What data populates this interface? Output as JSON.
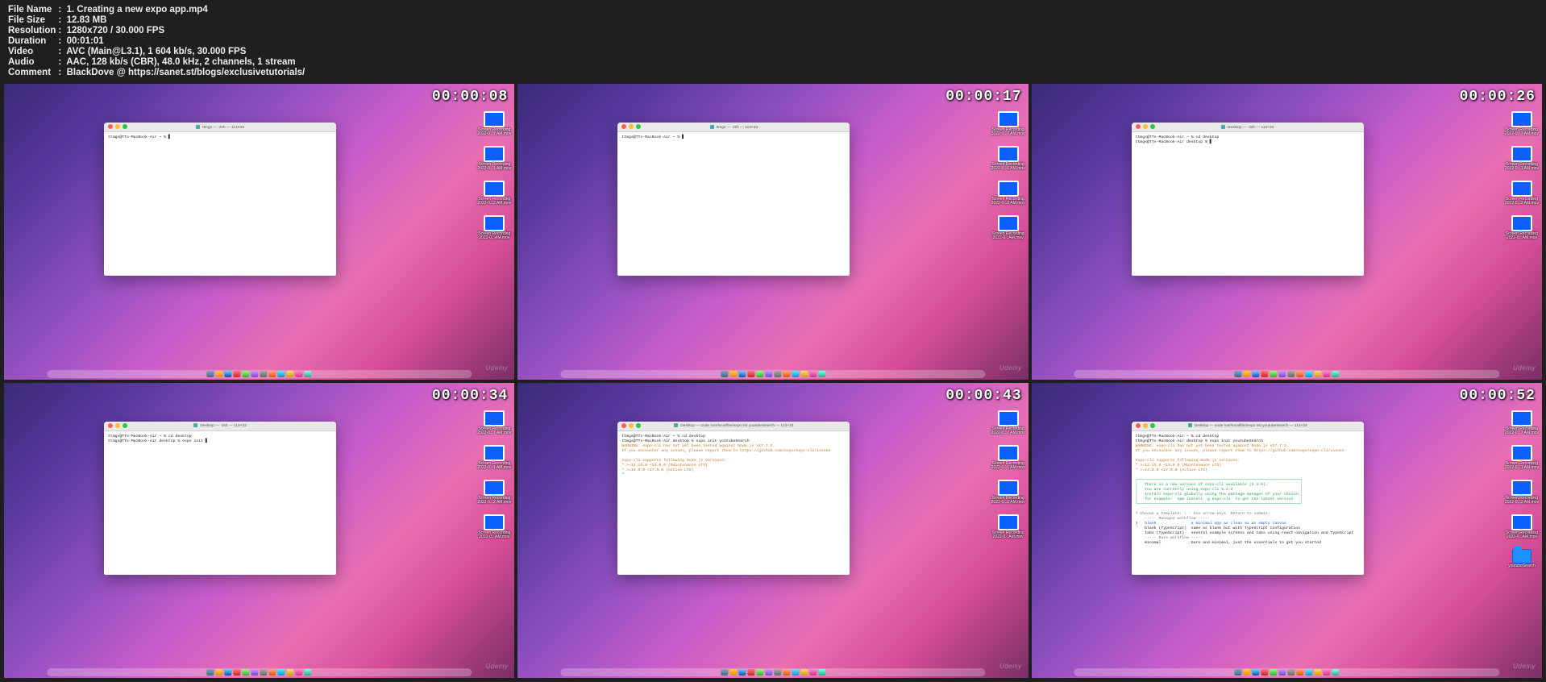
{
  "meta": {
    "file_name_label": "File Name",
    "file_name": "1. Creating a new expo app.mp4",
    "file_size_label": "File Size",
    "file_size": "12.83 MB",
    "resolution_label": "Resolution",
    "resolution": "1280x720 / 30.000 FPS",
    "duration_label": "Duration",
    "duration": "00:01:01",
    "video_label": "Video",
    "video": "AVC (Main@L3.1), 1 604 kb/s, 30.000 FPS",
    "audio_label": "Audio",
    "audio": "AAC, 128 kb/s (CBR), 48.0 kHz, 2 channels, 1 stream",
    "comment_label": "Comment",
    "comment": "BlackDove @ https://sanet.st/blogs/exclusivetutorials/",
    "sep": "  :  "
  },
  "frames": {
    "ts": [
      "00:00:08",
      "00:00:17",
      "00:00:26",
      "00:00:34",
      "00:00:43",
      "00:00:52"
    ],
    "term_titles": {
      "zsh": "ttmgs — -zsh — 113×33",
      "desk": "Desktop — -zsh — 113×33",
      "node": "Desktop — node /usr/local/bin/expo init youtubeSearch — 113×33"
    },
    "prompts": {
      "p1": "ttmgs@TTs-MacBook-Air ~ % ",
      "p1cd": "ttmgs@TTs-MacBook-Air ~ % cd desktop",
      "p2": "ttmgs@TTs-MacBook-Air desktop % ",
      "p2expo": "ttmgs@TTs-MacBook-Air desktop % expo init ",
      "p2expo2": "ttmgs@TTs-MacBook-Air desktop % expo init youtubeSearch"
    },
    "expo_out": {
      "warn": "WARNING: expo-cli has not yet been tested against Node.js v17.7.2.",
      "issues": "If you encounter any issues, please report them to https://github.com/expo/expo-cli/issues",
      "sup1": "expo-cli supports following Node.js versions:",
      "sup2": "* >=12.13.0 <13.0.0 (Maintenance LTS)",
      "sup3": "* >=14.0.0 <17.0.0 (Active LTS)",
      "boxTop": "┌──────────────────────────────────────────────────────────────────────┐",
      "boxL1": "│   There is a new version of expo-cli available (5.4.9).              │",
      "boxL2": "│   You are currently using expo-cli 5.3.2                             │",
      "boxL3": "│   Install expo-cli globally using the package manager of your choice;│",
      "boxL4": "│   for example: `npm install -g expo-cli` to get the latest version   │",
      "boxBot": "└──────────────────────────────────────────────────────────────────────┘",
      "choose": "? Choose a template: › - Use arrow-keys. Return to submit.",
      "mw": "    ----- Managed workflow -----",
      "opt_blank_sel": "❯   blank               a minimal app as clean as an empty canvas",
      "opt_blank_ts": "    blank (TypeScript)  same as blank but with TypeScript configuration",
      "opt_tabs": "    tabs (TypeScript)   several example screens and tabs using react-navigation and TypeScript",
      "bw": "    ----- Bare workflow -----",
      "opt_min": "    minimal             bare and minimal, just the essentials to get you started"
    },
    "watermark": "Udemy",
    "desk_icons": {
      "rec1_a": "Screen Recording",
      "rec1_b": "2022-0...7 AM.mov",
      "rec2_a": "Screen Recording",
      "rec2_b": "2022-0...1 AM.mov",
      "rec3_a": "Screen Recording",
      "rec3_b": "2022-0...2 AM.mov",
      "rec4_a": "Screen Recording",
      "rec4_b": "2022-0...AM.mov",
      "folder": "youtubeSearch"
    }
  }
}
